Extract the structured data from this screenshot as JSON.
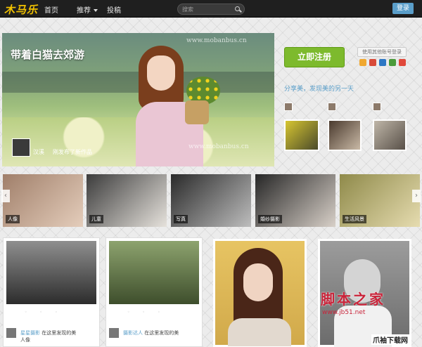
{
  "header": {
    "logo": "木马乐",
    "nav": [
      {
        "label": "首页"
      },
      {
        "label": "推荐",
        "has_dropdown": true
      },
      {
        "label": "投稿"
      }
    ],
    "search": {
      "placeholder": "搜索"
    },
    "login_label": "登录"
  },
  "hero": {
    "title": "带着白猫去郊游",
    "user_name": "汉溪",
    "user_sub": "刚发布了新作品",
    "watermark": "www.mobanbus.cn"
  },
  "side_panel": {
    "signup_label": "立即注册",
    "other_login_label": "使用其他账号登录",
    "tagline": "分享美，发现美的另一天",
    "social_icons": [
      "qq-icon",
      "weibo-icon",
      "renren-icon",
      "douban-icon",
      "kaixin-icon"
    ]
  },
  "strip": {
    "items": [
      {
        "label": "人像"
      },
      {
        "label": "儿童"
      },
      {
        "label": "写真"
      },
      {
        "label": "婚纱摄影"
      },
      {
        "label": "生活风景"
      }
    ]
  },
  "cards": [
    {
      "name": "星星摄影",
      "sub": "在这里发现的美",
      "tag": "人像"
    },
    {
      "name": "摄影达人",
      "sub": "在这里发现的美",
      "tag": ""
    }
  ],
  "watermark": {
    "text": "脚本之家",
    "url": "www.jb51.net"
  },
  "corner_badge": "爪袖下载网",
  "colors": {
    "accent_blue": "#5a9ec9",
    "signup_green": "#7dba2d",
    "logo_yellow": "#f2c200",
    "topbar": "#1f1f1f"
  }
}
